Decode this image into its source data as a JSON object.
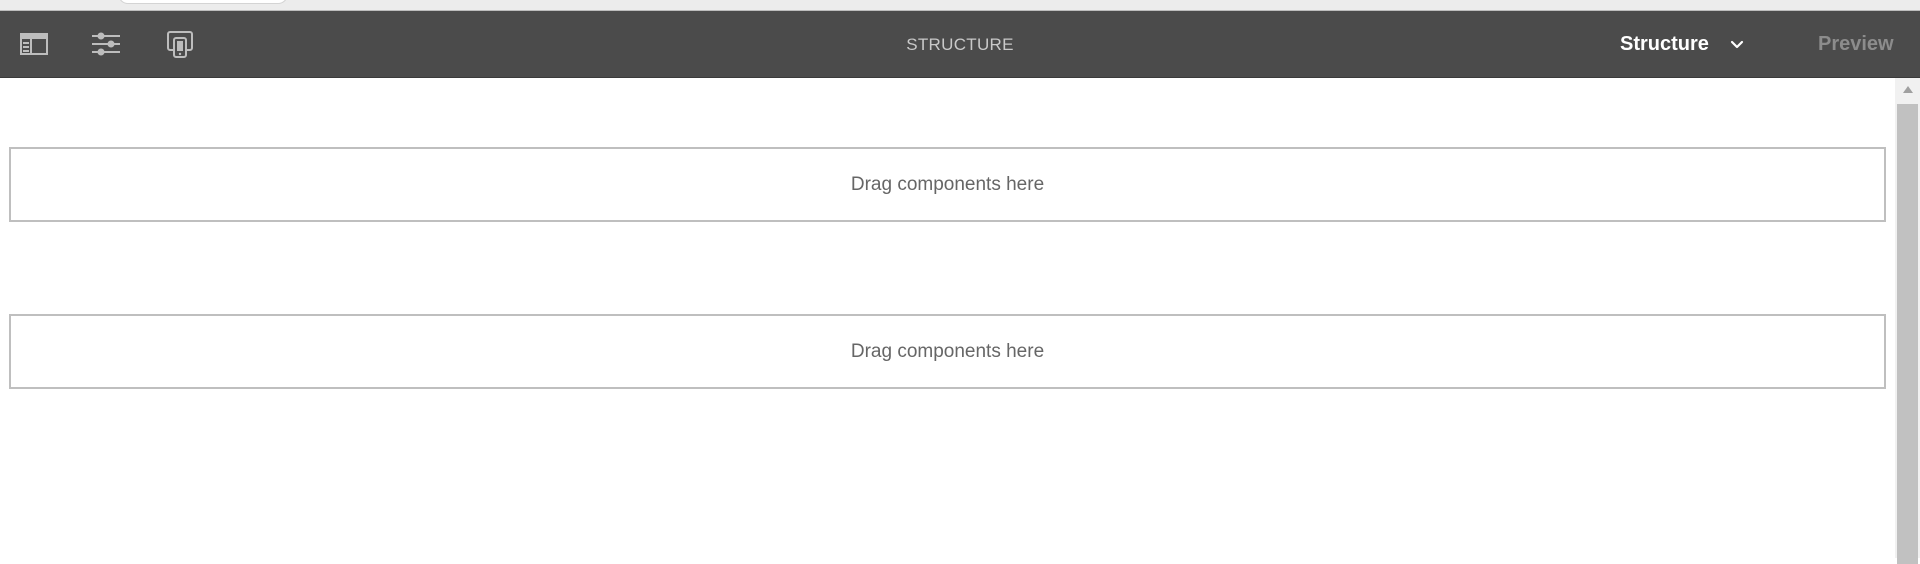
{
  "toolbar": {
    "title": "STRUCTURE",
    "mode_select": {
      "value": "Structure"
    },
    "preview_label": "Preview",
    "icons": [
      "toggle-side-panel-icon",
      "page-properties-icon",
      "emulator-icon"
    ]
  },
  "dropzones": [
    {
      "placeholder": "Drag components here"
    },
    {
      "placeholder": "Drag components here"
    }
  ],
  "colors": {
    "toolbar_bg": "#4b4b4b",
    "dropzone_border": "#bfbfbf"
  }
}
